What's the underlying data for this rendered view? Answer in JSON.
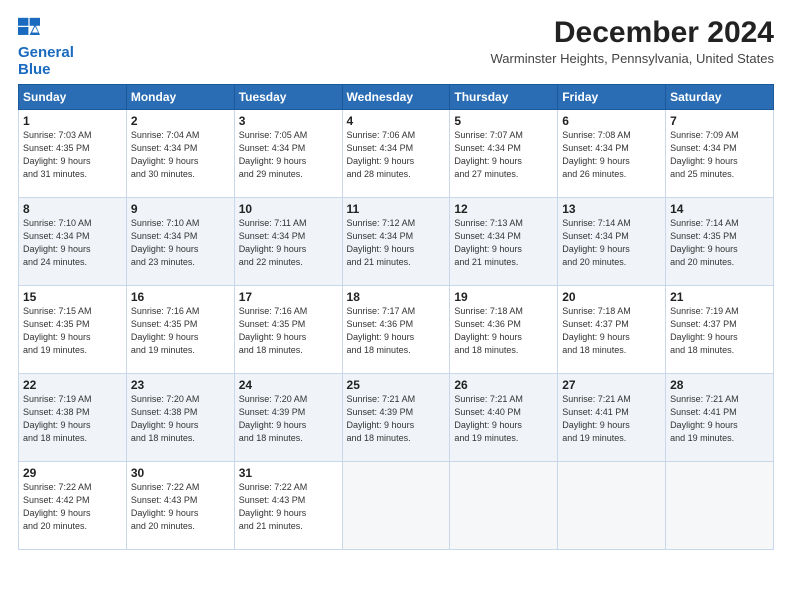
{
  "header": {
    "logo_line1": "General",
    "logo_line2": "Blue",
    "month_title": "December 2024",
    "subtitle": "Warminster Heights, Pennsylvania, United States"
  },
  "weekdays": [
    "Sunday",
    "Monday",
    "Tuesday",
    "Wednesday",
    "Thursday",
    "Friday",
    "Saturday"
  ],
  "weeks": [
    [
      {
        "day": "1",
        "sunrise": "7:03 AM",
        "sunset": "4:35 PM",
        "daylight": "9 hours and 31 minutes."
      },
      {
        "day": "2",
        "sunrise": "7:04 AM",
        "sunset": "4:34 PM",
        "daylight": "9 hours and 30 minutes."
      },
      {
        "day": "3",
        "sunrise": "7:05 AM",
        "sunset": "4:34 PM",
        "daylight": "9 hours and 29 minutes."
      },
      {
        "day": "4",
        "sunrise": "7:06 AM",
        "sunset": "4:34 PM",
        "daylight": "9 hours and 28 minutes."
      },
      {
        "day": "5",
        "sunrise": "7:07 AM",
        "sunset": "4:34 PM",
        "daylight": "9 hours and 27 minutes."
      },
      {
        "day": "6",
        "sunrise": "7:08 AM",
        "sunset": "4:34 PM",
        "daylight": "9 hours and 26 minutes."
      },
      {
        "day": "7",
        "sunrise": "7:09 AM",
        "sunset": "4:34 PM",
        "daylight": "9 hours and 25 minutes."
      }
    ],
    [
      {
        "day": "8",
        "sunrise": "7:10 AM",
        "sunset": "4:34 PM",
        "daylight": "9 hours and 24 minutes."
      },
      {
        "day": "9",
        "sunrise": "7:10 AM",
        "sunset": "4:34 PM",
        "daylight": "9 hours and 23 minutes."
      },
      {
        "day": "10",
        "sunrise": "7:11 AM",
        "sunset": "4:34 PM",
        "daylight": "9 hours and 22 minutes."
      },
      {
        "day": "11",
        "sunrise": "7:12 AM",
        "sunset": "4:34 PM",
        "daylight": "9 hours and 21 minutes."
      },
      {
        "day": "12",
        "sunrise": "7:13 AM",
        "sunset": "4:34 PM",
        "daylight": "9 hours and 21 minutes."
      },
      {
        "day": "13",
        "sunrise": "7:14 AM",
        "sunset": "4:34 PM",
        "daylight": "9 hours and 20 minutes."
      },
      {
        "day": "14",
        "sunrise": "7:14 AM",
        "sunset": "4:35 PM",
        "daylight": "9 hours and 20 minutes."
      }
    ],
    [
      {
        "day": "15",
        "sunrise": "7:15 AM",
        "sunset": "4:35 PM",
        "daylight": "9 hours and 19 minutes."
      },
      {
        "day": "16",
        "sunrise": "7:16 AM",
        "sunset": "4:35 PM",
        "daylight": "9 hours and 19 minutes."
      },
      {
        "day": "17",
        "sunrise": "7:16 AM",
        "sunset": "4:35 PM",
        "daylight": "9 hours and 18 minutes."
      },
      {
        "day": "18",
        "sunrise": "7:17 AM",
        "sunset": "4:36 PM",
        "daylight": "9 hours and 18 minutes."
      },
      {
        "day": "19",
        "sunrise": "7:18 AM",
        "sunset": "4:36 PM",
        "daylight": "9 hours and 18 minutes."
      },
      {
        "day": "20",
        "sunrise": "7:18 AM",
        "sunset": "4:37 PM",
        "daylight": "9 hours and 18 minutes."
      },
      {
        "day": "21",
        "sunrise": "7:19 AM",
        "sunset": "4:37 PM",
        "daylight": "9 hours and 18 minutes."
      }
    ],
    [
      {
        "day": "22",
        "sunrise": "7:19 AM",
        "sunset": "4:38 PM",
        "daylight": "9 hours and 18 minutes."
      },
      {
        "day": "23",
        "sunrise": "7:20 AM",
        "sunset": "4:38 PM",
        "daylight": "9 hours and 18 minutes."
      },
      {
        "day": "24",
        "sunrise": "7:20 AM",
        "sunset": "4:39 PM",
        "daylight": "9 hours and 18 minutes."
      },
      {
        "day": "25",
        "sunrise": "7:21 AM",
        "sunset": "4:39 PM",
        "daylight": "9 hours and 18 minutes."
      },
      {
        "day": "26",
        "sunrise": "7:21 AM",
        "sunset": "4:40 PM",
        "daylight": "9 hours and 19 minutes."
      },
      {
        "day": "27",
        "sunrise": "7:21 AM",
        "sunset": "4:41 PM",
        "daylight": "9 hours and 19 minutes."
      },
      {
        "day": "28",
        "sunrise": "7:21 AM",
        "sunset": "4:41 PM",
        "daylight": "9 hours and 19 minutes."
      }
    ],
    [
      {
        "day": "29",
        "sunrise": "7:22 AM",
        "sunset": "4:42 PM",
        "daylight": "9 hours and 20 minutes."
      },
      {
        "day": "30",
        "sunrise": "7:22 AM",
        "sunset": "4:43 PM",
        "daylight": "9 hours and 20 minutes."
      },
      {
        "day": "31",
        "sunrise": "7:22 AM",
        "sunset": "4:43 PM",
        "daylight": "9 hours and 21 minutes."
      },
      null,
      null,
      null,
      null
    ]
  ],
  "labels": {
    "sunrise": "Sunrise:",
    "sunset": "Sunset:",
    "daylight": "Daylight:"
  }
}
